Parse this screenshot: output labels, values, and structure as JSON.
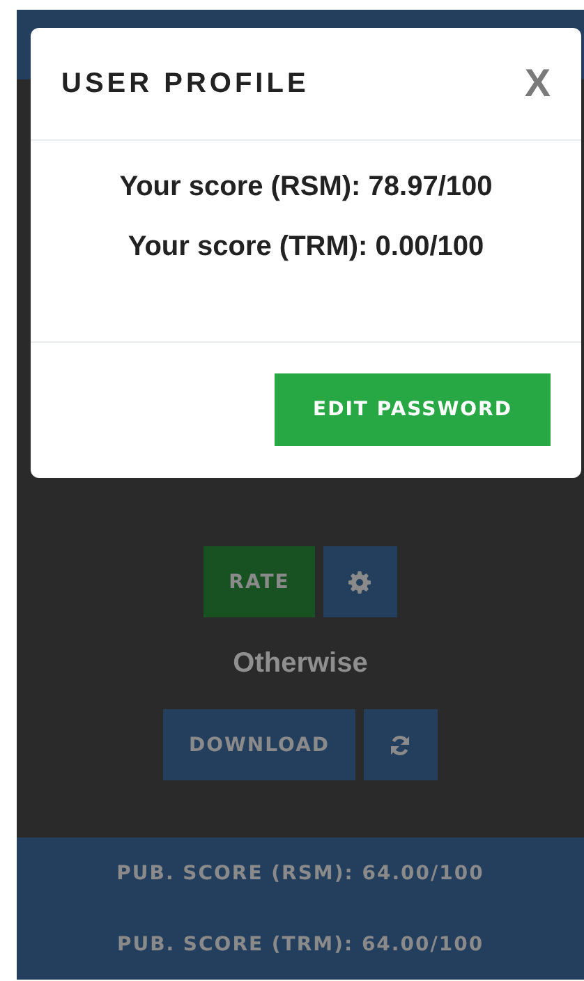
{
  "modal": {
    "title": "USER PROFILE",
    "close": "X",
    "lines": [
      "Your score (RSM): 78.97/100",
      "Your score (TRM): 0.00/100"
    ],
    "button": "EDIT PASSWORD"
  },
  "rate_button": "RATE",
  "status": "Otherwise",
  "download_button": "DOWNLOAD",
  "public_scores": [
    "PUB. SCORE (RSM): 64.00/100",
    "PUB. SCORE (TRM): 64.00/100"
  ]
}
